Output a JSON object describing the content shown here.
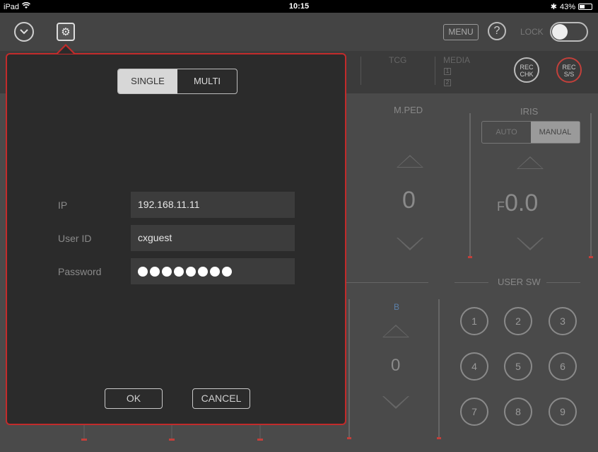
{
  "status_bar": {
    "device": "iPad",
    "time": "10:15",
    "battery": "43%"
  },
  "toolbar": {
    "menu_label": "MENU",
    "help_label": "?",
    "lock_label": "LOCK"
  },
  "panel": {
    "tcg_label": "TCG",
    "media_label": "MEDIA",
    "media_slots": [
      "1",
      "2"
    ],
    "rec_chk": "REC\nCHK",
    "rec_ss": "REC\nS/S",
    "mped_label": "M.PED",
    "mped_value": "0",
    "iris_label": "IRIS",
    "iris_modes": [
      "AUTO",
      "MANUAL"
    ],
    "iris_prefix": "F",
    "iris_value": "0.0",
    "b_label": "B",
    "b_value": "0",
    "user_sw_label": "USER SW",
    "user_sw_buttons": [
      "1",
      "2",
      "3",
      "4",
      "5",
      "6",
      "7",
      "8",
      "9"
    ]
  },
  "dialog": {
    "mode_single": "SINGLE",
    "mode_multi": "MULTI",
    "ip_label": "IP",
    "ip_value": "192.168.11.11",
    "userid_label": "User ID",
    "userid_value": "cxguest",
    "password_label": "Password",
    "password_mask_count": 8,
    "ok_label": "OK",
    "cancel_label": "CANCEL"
  },
  "colors": {
    "accent_red": "#c22b2b",
    "background": "#4a4a4a",
    "dialog_bg": "#2b2b2b"
  },
  "icons": {
    "collapse": "chevron-down-circle-icon",
    "settings": "gear-icon",
    "wifi": "wifi-icon",
    "bluetooth": "bluetooth-icon"
  }
}
